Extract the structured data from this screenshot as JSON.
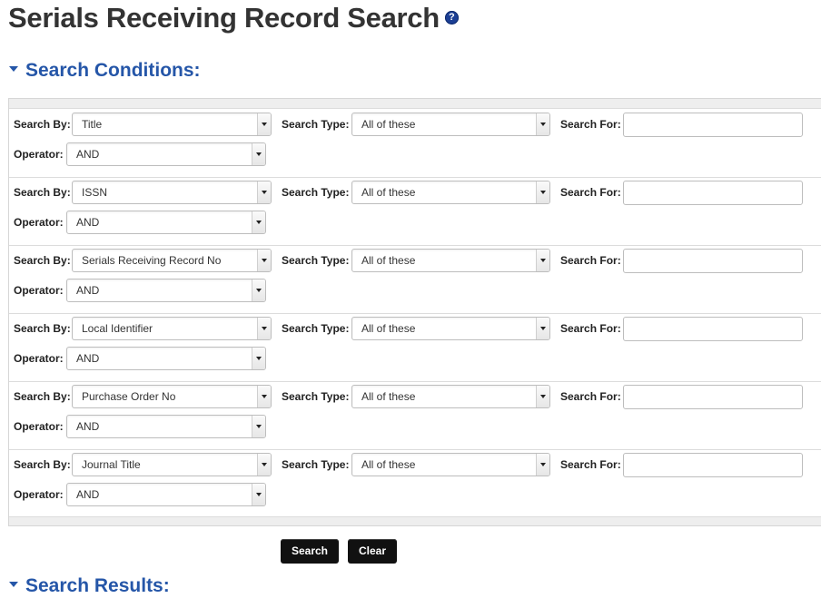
{
  "page": {
    "title": "Serials Receiving Record Search",
    "help_icon": "question-mark-icon"
  },
  "sections": {
    "conditions_heading": "Search Conditions:",
    "results_heading": "Search Results:"
  },
  "labels": {
    "search_by": "Search By:",
    "search_type": "Search Type:",
    "search_for": "Search For:",
    "operator": "Operator:"
  },
  "rows": [
    {
      "search_by": "Title",
      "search_type": "All of these",
      "search_for": "",
      "operator": "AND"
    },
    {
      "search_by": "ISSN",
      "search_type": "All of these",
      "search_for": "",
      "operator": "AND"
    },
    {
      "search_by": "Serials Receiving Record No",
      "search_type": "All of these",
      "search_for": "",
      "operator": "AND"
    },
    {
      "search_by": "Local Identifier",
      "search_type": "All of these",
      "search_for": "",
      "operator": "AND"
    },
    {
      "search_by": "Purchase Order No",
      "search_type": "All of these",
      "search_for": "",
      "operator": "AND"
    },
    {
      "search_by": "Journal Title",
      "search_type": "All of these",
      "search_for": "",
      "operator": "AND"
    }
  ],
  "buttons": {
    "search": "Search",
    "clear": "Clear"
  },
  "colors": {
    "heading_blue": "#2556a8",
    "button_bg": "#111111"
  }
}
